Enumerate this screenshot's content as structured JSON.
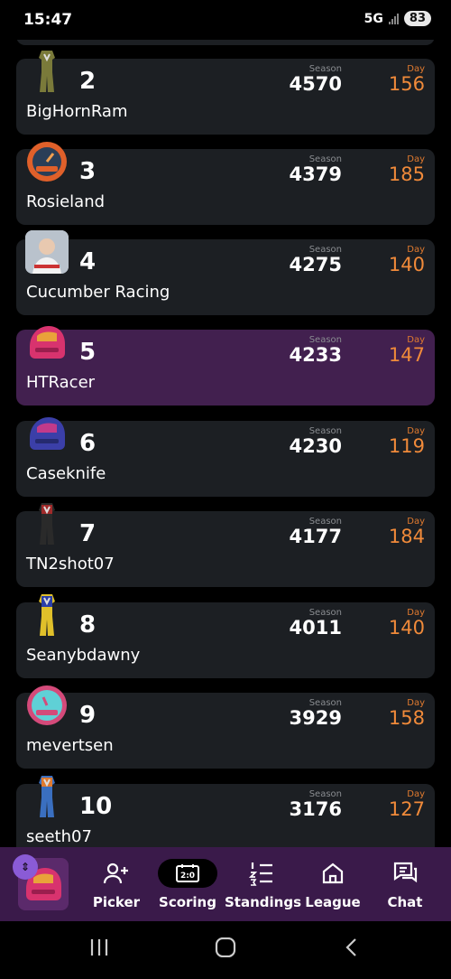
{
  "status_bar": {
    "time": "15:47",
    "network": "5G",
    "battery": "83"
  },
  "labels": {
    "season": "Season",
    "day": "Day"
  },
  "standings": [
    {
      "rank": "2",
      "name": "BigHornRam",
      "season": "4570",
      "day": "156",
      "avatar": "firesuit-olive-icon",
      "highlight": false
    },
    {
      "rank": "3",
      "name": "Rosieland",
      "season": "4379",
      "day": "185",
      "avatar": "fantrax-gauge-orange-icon",
      "highlight": false
    },
    {
      "rank": "4",
      "name": "Cucumber Racing",
      "season": "4275",
      "day": "140",
      "avatar": "driver-photo-icon",
      "highlight": false
    },
    {
      "rank": "5",
      "name": "HTRacer",
      "season": "4233",
      "day": "147",
      "avatar": "helmet-pink-icon",
      "highlight": true
    },
    {
      "rank": "6",
      "name": "Caseknife",
      "season": "4230",
      "day": "119",
      "avatar": "helmet-purple-icon",
      "highlight": false
    },
    {
      "rank": "7",
      "name": "TN2shot07",
      "season": "4177",
      "day": "184",
      "avatar": "firesuit-black-red-icon",
      "highlight": false
    },
    {
      "rank": "8",
      "name": "Seanybdawny",
      "season": "4011",
      "day": "140",
      "avatar": "firesuit-blue-yellow-icon",
      "highlight": false
    },
    {
      "rank": "9",
      "name": "mevertsen",
      "season": "3929",
      "day": "158",
      "avatar": "fantrax-gauge-teal-icon",
      "highlight": false
    },
    {
      "rank": "10",
      "name": "seeth07",
      "season": "3176",
      "day": "127",
      "avatar": "firesuit-blue-orange-icon",
      "highlight": false
    }
  ],
  "tabbar": {
    "tabs": [
      {
        "label": "Picker",
        "icon": "add-user-icon"
      },
      {
        "label": "Scoring",
        "icon": "scoreboard-icon"
      },
      {
        "label": "Standings",
        "icon": "numbered-list-icon"
      },
      {
        "label": "League",
        "icon": "home-icon"
      },
      {
        "label": "Chat",
        "icon": "chat-icon"
      }
    ]
  },
  "colors": {
    "card": "#1c1f23",
    "highlight": "#42204f",
    "day_accent": "#f08a3a",
    "tabbar": "#3a1a4a"
  }
}
